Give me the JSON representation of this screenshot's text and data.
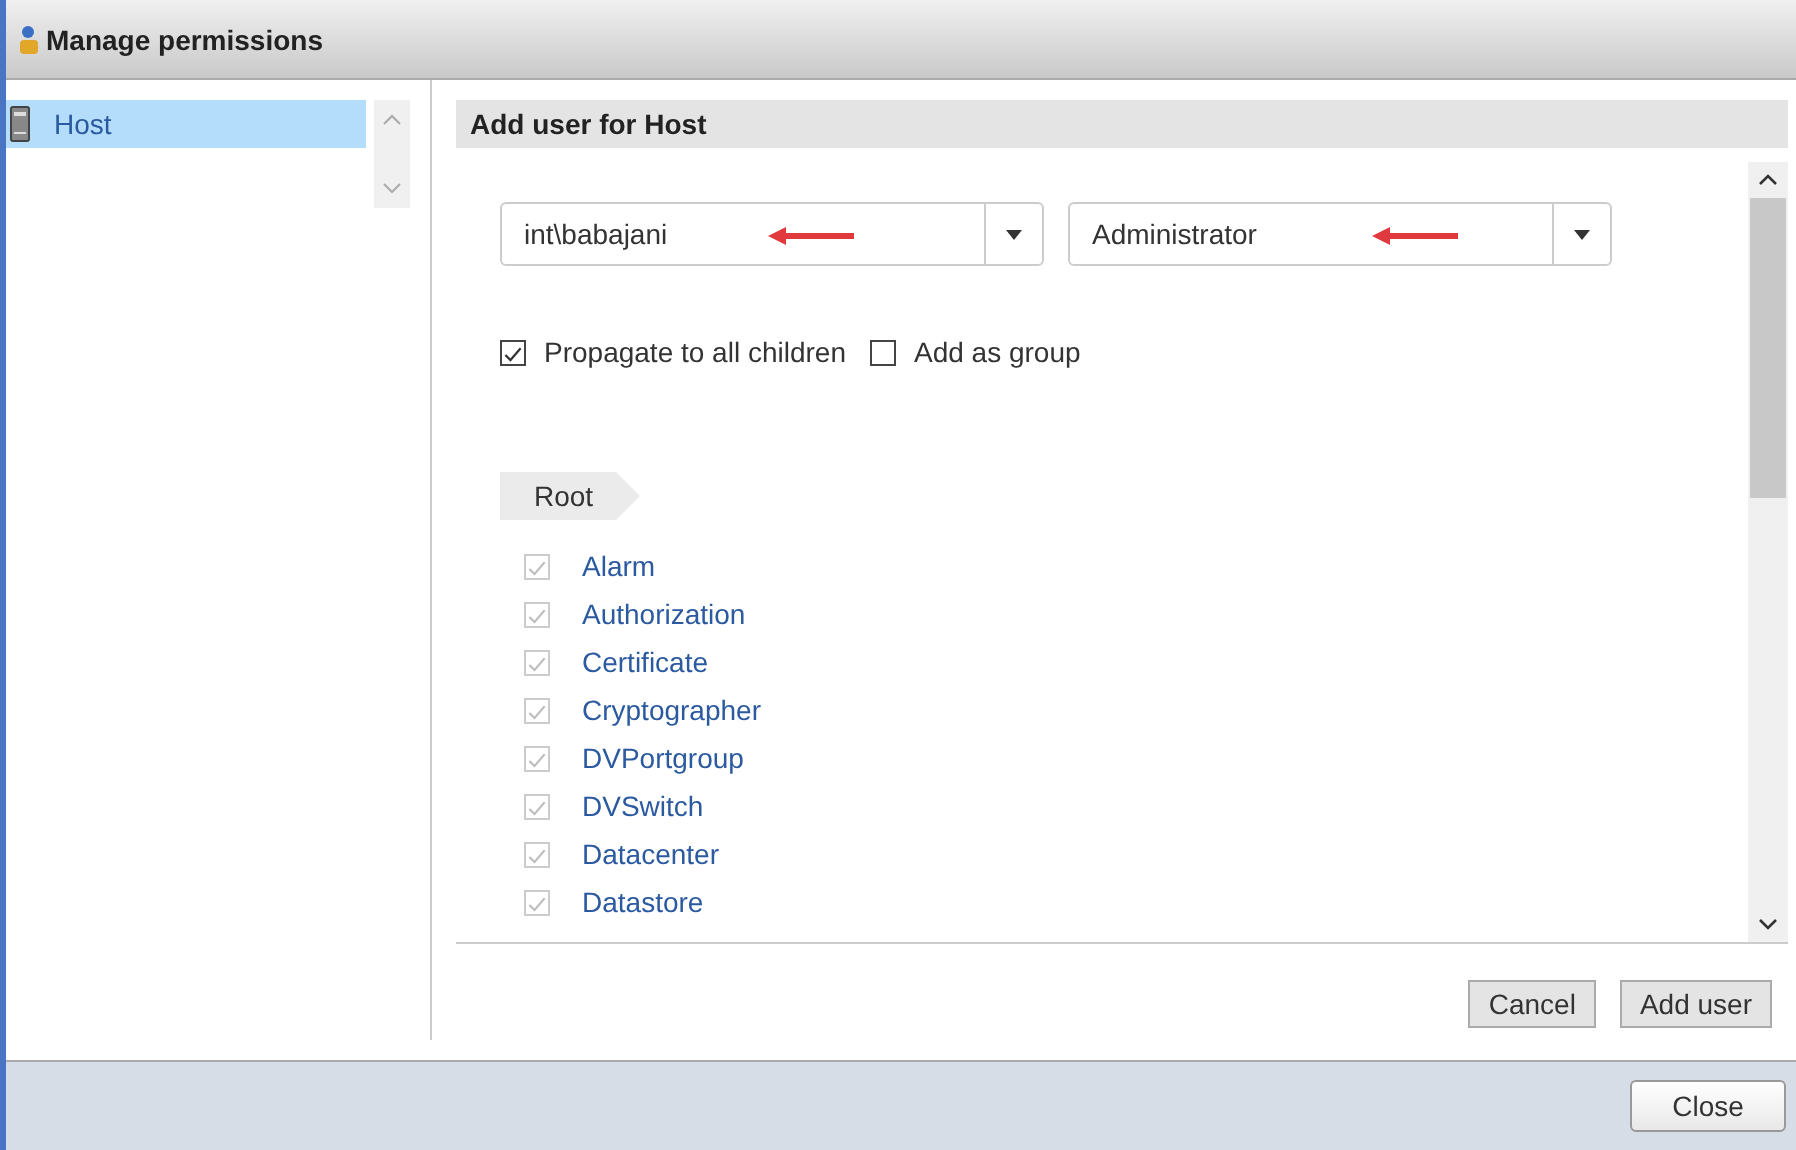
{
  "window": {
    "title": "Manage permissions"
  },
  "sidebar": {
    "items": [
      {
        "label": "Host",
        "selected": true
      }
    ]
  },
  "panel": {
    "title": "Add user for Host",
    "user_select": {
      "value": "int\\babajani"
    },
    "role_select": {
      "value": "Administrator"
    },
    "options": [
      {
        "label": "Propagate to all children",
        "checked": true
      },
      {
        "label": "Add as group",
        "checked": false
      }
    ],
    "breadcrumb": "Root",
    "privileges": [
      {
        "label": "Alarm",
        "checked": true,
        "disabled": true
      },
      {
        "label": "Authorization",
        "checked": true,
        "disabled": true
      },
      {
        "label": "Certificate",
        "checked": true,
        "disabled": true
      },
      {
        "label": "Cryptographer",
        "checked": true,
        "disabled": true
      },
      {
        "label": "DVPortgroup",
        "checked": true,
        "disabled": true
      },
      {
        "label": "DVSwitch",
        "checked": true,
        "disabled": true
      },
      {
        "label": "Datacenter",
        "checked": true,
        "disabled": true
      },
      {
        "label": "Datastore",
        "checked": true,
        "disabled": true
      }
    ],
    "buttons": [
      "Cancel",
      "Add user"
    ]
  },
  "footer": {
    "buttons": [
      "Close"
    ]
  }
}
